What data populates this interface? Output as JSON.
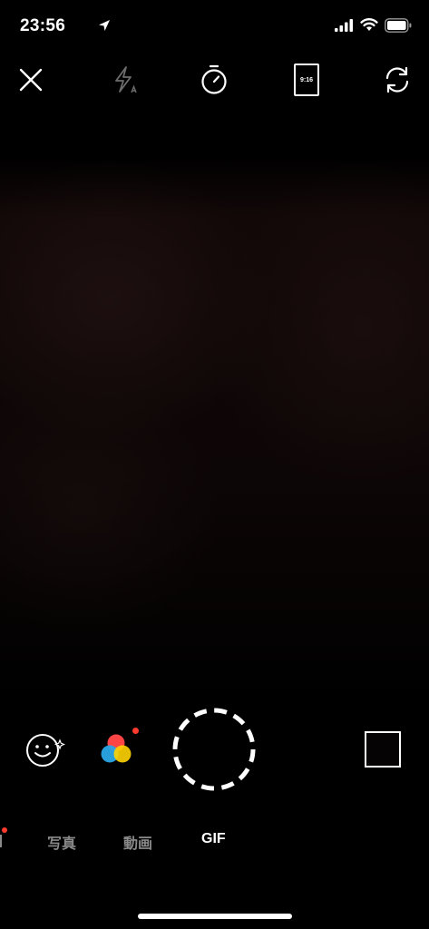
{
  "status_bar": {
    "time": "23:56",
    "icons": [
      "location-arrow-icon",
      "cellular-signal-icon",
      "wifi-icon",
      "battery-icon"
    ]
  },
  "toolbar": {
    "icons": [
      "close-icon",
      "flash-auto-icon",
      "timer-icon",
      "aspect-ratio-icon",
      "switch-camera-icon"
    ],
    "aspect_ratio_label": "9:16"
  },
  "controls": {
    "icons": [
      "face-effects-icon",
      "color-filter-icon",
      "shutter-button",
      "gallery-thumbnail"
    ]
  },
  "modes": {
    "items": [
      "写真",
      "動画",
      "GIF"
    ],
    "active": "GIF"
  },
  "colors": {
    "background": "#000000",
    "active_mode": "#ffffff",
    "inactive_mode": "#8a8a8a",
    "badge": "#ff3b30",
    "filter_red": "#ff4444",
    "filter_yellow": "#ffd400",
    "filter_blue": "#2aa7e6"
  }
}
